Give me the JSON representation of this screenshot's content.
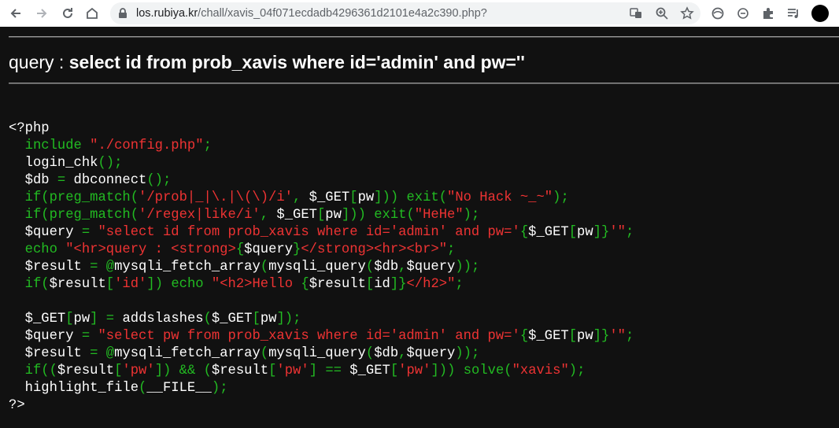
{
  "browser": {
    "url_host": "los.rubiya.kr",
    "url_path": "/chall/xavis_04f071ecdadb4296361d2101e4a2c390.php?",
    "icons": [
      "back-icon",
      "forward-icon",
      "reload-icon",
      "home-icon",
      "lock-icon",
      "translate-icon",
      "zoom-icon",
      "bookmark-star-icon",
      "extension-icon",
      "stop-icon",
      "puzzle-icon",
      "media-icon",
      "profile-avatar"
    ]
  },
  "query": {
    "prefix": "query : ",
    "sql": "select id from prob_xavis where id='admin' and pw=''"
  },
  "source": {
    "lines": [
      [
        [
          "d",
          "<?php"
        ]
      ],
      [
        [
          "k",
          "  include "
        ],
        [
          "s",
          "\"./config.php\""
        ],
        [
          "k",
          ";"
        ]
      ],
      [
        [
          "d",
          "  login_chk"
        ],
        [
          "k",
          "();"
        ]
      ],
      [
        [
          "d",
          "  $db "
        ],
        [
          "k",
          "= "
        ],
        [
          "d",
          "dbconnect"
        ],
        [
          "k",
          "();"
        ]
      ],
      [
        [
          "k",
          "  if(preg_match("
        ],
        [
          "s",
          "'/prob|_|\\.|\\(\\)/i'"
        ],
        [
          "k",
          ", "
        ],
        [
          "d",
          "$_GET"
        ],
        [
          "k",
          "["
        ],
        [
          "d",
          "pw"
        ],
        [
          "k",
          "])) exit("
        ],
        [
          "s",
          "\"No Hack ~_~\""
        ],
        [
          "k",
          ");"
        ]
      ],
      [
        [
          "k",
          "  if(preg_match("
        ],
        [
          "s",
          "'/regex|like/i'"
        ],
        [
          "k",
          ", "
        ],
        [
          "d",
          "$_GET"
        ],
        [
          "k",
          "["
        ],
        [
          "d",
          "pw"
        ],
        [
          "k",
          "])) exit("
        ],
        [
          "s",
          "\"HeHe\""
        ],
        [
          "k",
          ");"
        ]
      ],
      [
        [
          "d",
          "  $query "
        ],
        [
          "k",
          "= "
        ],
        [
          "s",
          "\"select id from prob_xavis where id='admin' and pw='"
        ],
        [
          "k",
          "{"
        ],
        [
          "d",
          "$_GET"
        ],
        [
          "k",
          "["
        ],
        [
          "d",
          "pw"
        ],
        [
          "k",
          "]}"
        ],
        [
          "s",
          "'\""
        ],
        [
          "k",
          ";"
        ]
      ],
      [
        [
          "k",
          "  echo "
        ],
        [
          "s",
          "\"<hr>query : <strong>"
        ],
        [
          "k",
          "{"
        ],
        [
          "d",
          "$query"
        ],
        [
          "k",
          "}"
        ],
        [
          "s",
          "</strong><hr><br>\""
        ],
        [
          "k",
          ";"
        ]
      ],
      [
        [
          "d",
          "  $result "
        ],
        [
          "k",
          "= @"
        ],
        [
          "d",
          "mysqli_fetch_array"
        ],
        [
          "k",
          "("
        ],
        [
          "d",
          "mysqli_query"
        ],
        [
          "k",
          "("
        ],
        [
          "d",
          "$db"
        ],
        [
          "k",
          ","
        ],
        [
          "d",
          "$query"
        ],
        [
          "k",
          "));"
        ]
      ],
      [
        [
          "k",
          "  if("
        ],
        [
          "d",
          "$result"
        ],
        [
          "k",
          "["
        ],
        [
          "s",
          "'id'"
        ],
        [
          "k",
          "]) echo "
        ],
        [
          "s",
          "\"<h2>Hello "
        ],
        [
          "k",
          "{"
        ],
        [
          "d",
          "$result"
        ],
        [
          "k",
          "["
        ],
        [
          "d",
          "id"
        ],
        [
          "k",
          "]}"
        ],
        [
          "s",
          "</h2>\""
        ],
        [
          "k",
          ";"
        ]
      ],
      [
        [
          "d",
          " "
        ]
      ],
      [
        [
          "d",
          "  $_GET"
        ],
        [
          "k",
          "["
        ],
        [
          "d",
          "pw"
        ],
        [
          "k",
          "] = "
        ],
        [
          "d",
          "addslashes"
        ],
        [
          "k",
          "("
        ],
        [
          "d",
          "$_GET"
        ],
        [
          "k",
          "["
        ],
        [
          "d",
          "pw"
        ],
        [
          "k",
          "]);"
        ]
      ],
      [
        [
          "d",
          "  $query "
        ],
        [
          "k",
          "= "
        ],
        [
          "s",
          "\"select pw from prob_xavis where id='admin' and pw='"
        ],
        [
          "k",
          "{"
        ],
        [
          "d",
          "$_GET"
        ],
        [
          "k",
          "["
        ],
        [
          "d",
          "pw"
        ],
        [
          "k",
          "]}"
        ],
        [
          "s",
          "'\""
        ],
        [
          "k",
          ";"
        ]
      ],
      [
        [
          "d",
          "  $result "
        ],
        [
          "k",
          "= @"
        ],
        [
          "d",
          "mysqli_fetch_array"
        ],
        [
          "k",
          "("
        ],
        [
          "d",
          "mysqli_query"
        ],
        [
          "k",
          "("
        ],
        [
          "d",
          "$db"
        ],
        [
          "k",
          ","
        ],
        [
          "d",
          "$query"
        ],
        [
          "k",
          "));"
        ]
      ],
      [
        [
          "k",
          "  if(("
        ],
        [
          "d",
          "$result"
        ],
        [
          "k",
          "["
        ],
        [
          "s",
          "'pw'"
        ],
        [
          "k",
          "]) && ("
        ],
        [
          "d",
          "$result"
        ],
        [
          "k",
          "["
        ],
        [
          "s",
          "'pw'"
        ],
        [
          "k",
          "] == "
        ],
        [
          "d",
          "$_GET"
        ],
        [
          "k",
          "["
        ],
        [
          "s",
          "'pw'"
        ],
        [
          "k",
          "])) solve("
        ],
        [
          "s",
          "\"xavis\""
        ],
        [
          "k",
          ");"
        ]
      ],
      [
        [
          "d",
          "  highlight_file"
        ],
        [
          "k",
          "("
        ],
        [
          "d",
          "__FILE__"
        ],
        [
          "k",
          ");"
        ]
      ],
      [
        [
          "d",
          "?>"
        ]
      ]
    ]
  }
}
